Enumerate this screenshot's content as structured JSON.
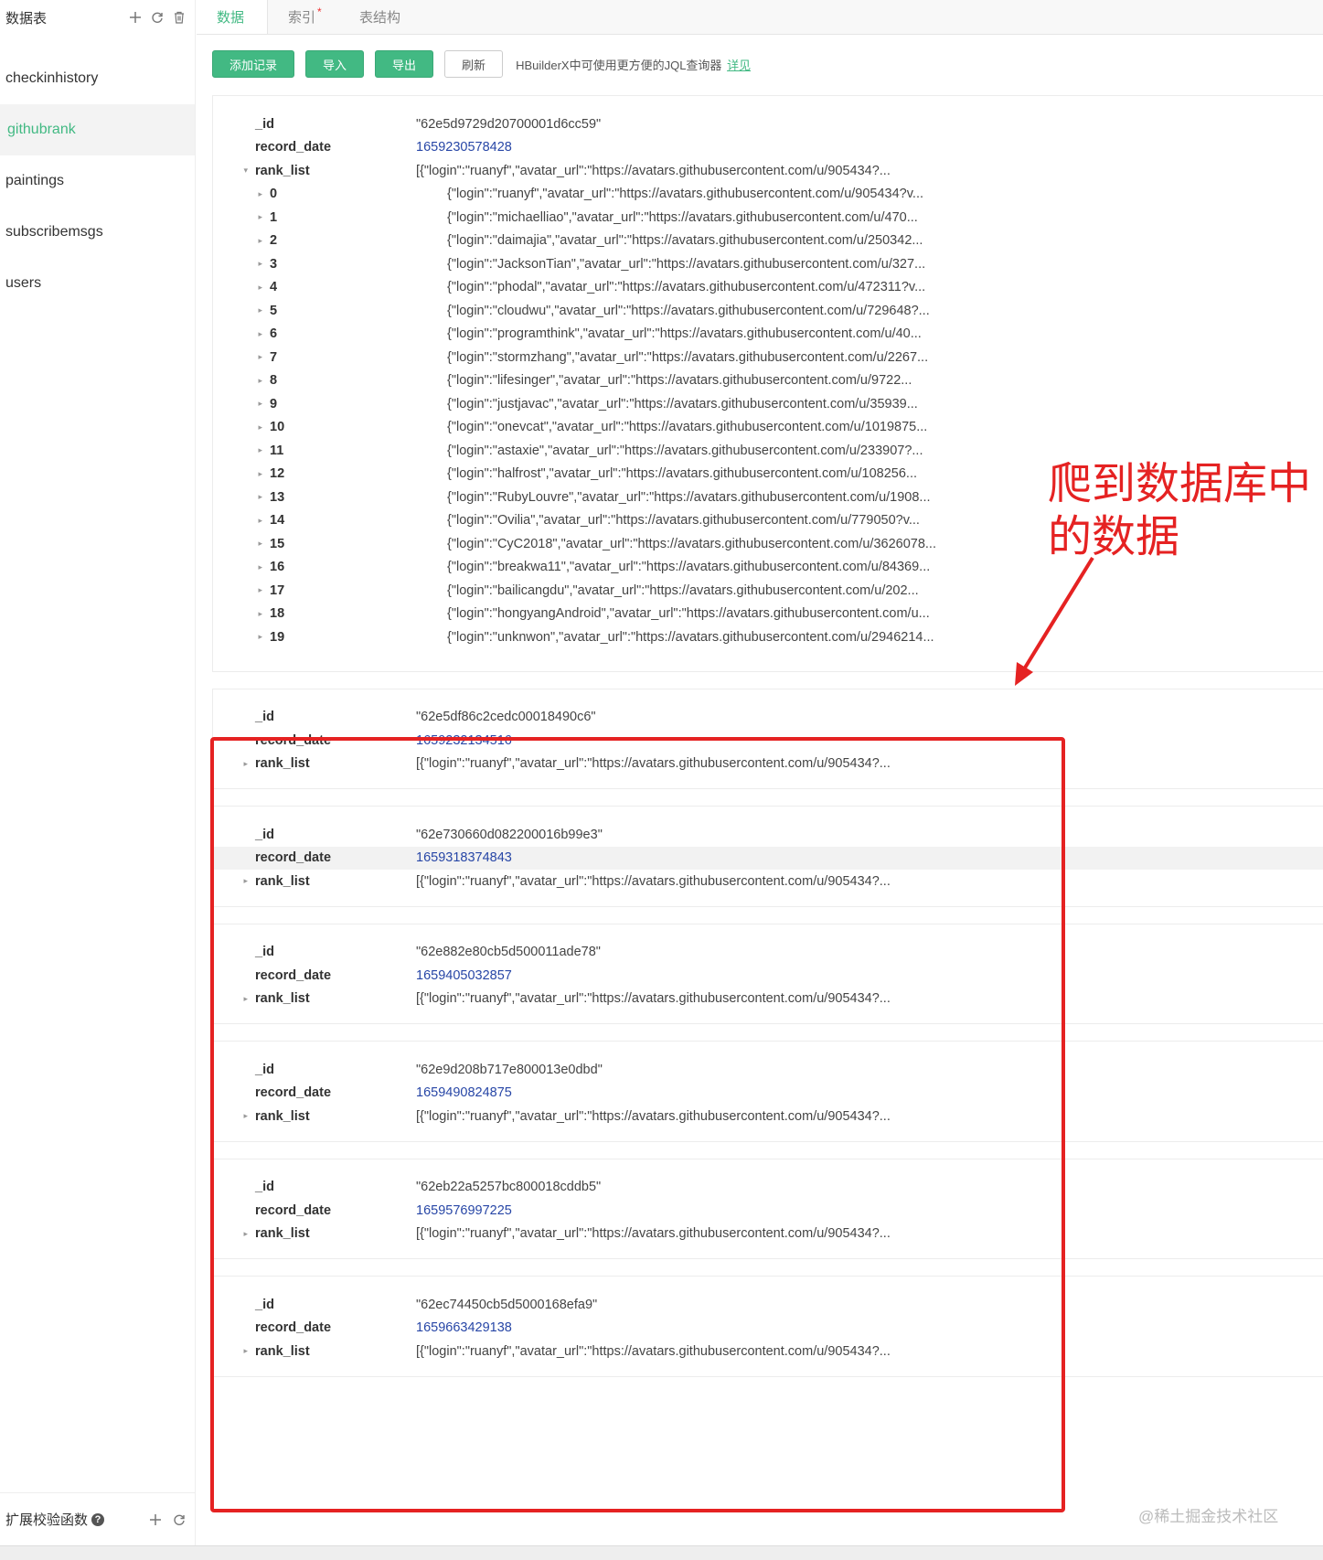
{
  "sidebar": {
    "title": "数据表",
    "items": [
      "checkinhistory",
      "githubrank",
      "paintings",
      "subscribemsgs",
      "users"
    ],
    "active_index": 1,
    "footer_title": "扩展校验函数",
    "help_glyph": "?"
  },
  "tabs": [
    {
      "label": "数据",
      "active": true
    },
    {
      "label": "索引",
      "active": false,
      "star": "*"
    },
    {
      "label": "表结构",
      "active": false
    }
  ],
  "toolbar": {
    "add": "添加记录",
    "import": "导入",
    "export": "导出",
    "refresh": "刷新",
    "note": "HBuilderX中可使用更方便的JQL查询器",
    "note_link": "详见"
  },
  "records": [
    {
      "id": "\"62e5d9729d20700001d6cc59\"",
      "record_date": "1659230578428",
      "rank_list": "[{\"login\":\"ruanyf\",\"avatar_url\":\"https://avatars.githubusercontent.com/u/905434?...",
      "expanded": true,
      "items": [
        {
          "i": "0",
          "v": "{\"login\":\"ruanyf\",\"avatar_url\":\"https://avatars.githubusercontent.com/u/905434?v..."
        },
        {
          "i": "1",
          "v": "{\"login\":\"michaelliao\",\"avatar_url\":\"https://avatars.githubusercontent.com/u/470..."
        },
        {
          "i": "2",
          "v": "{\"login\":\"daimajia\",\"avatar_url\":\"https://avatars.githubusercontent.com/u/250342..."
        },
        {
          "i": "3",
          "v": "{\"login\":\"JacksonTian\",\"avatar_url\":\"https://avatars.githubusercontent.com/u/327..."
        },
        {
          "i": "4",
          "v": "{\"login\":\"phodal\",\"avatar_url\":\"https://avatars.githubusercontent.com/u/472311?v..."
        },
        {
          "i": "5",
          "v": "{\"login\":\"cloudwu\",\"avatar_url\":\"https://avatars.githubusercontent.com/u/729648?..."
        },
        {
          "i": "6",
          "v": "{\"login\":\"programthink\",\"avatar_url\":\"https://avatars.githubusercontent.com/u/40..."
        },
        {
          "i": "7",
          "v": "{\"login\":\"stormzhang\",\"avatar_url\":\"https://avatars.githubusercontent.com/u/2267..."
        },
        {
          "i": "8",
          "v": "{\"login\":\"lifesinger\",\"avatar_url\":\"https://avatars.githubusercontent.com/u/9722..."
        },
        {
          "i": "9",
          "v": "{\"login\":\"justjavac\",\"avatar_url\":\"https://avatars.githubusercontent.com/u/35939..."
        },
        {
          "i": "10",
          "v": "{\"login\":\"onevcat\",\"avatar_url\":\"https://avatars.githubusercontent.com/u/1019875..."
        },
        {
          "i": "11",
          "v": "{\"login\":\"astaxie\",\"avatar_url\":\"https://avatars.githubusercontent.com/u/233907?..."
        },
        {
          "i": "12",
          "v": "{\"login\":\"halfrost\",\"avatar_url\":\"https://avatars.githubusercontent.com/u/108256..."
        },
        {
          "i": "13",
          "v": "{\"login\":\"RubyLouvre\",\"avatar_url\":\"https://avatars.githubusercontent.com/u/1908..."
        },
        {
          "i": "14",
          "v": "{\"login\":\"Ovilia\",\"avatar_url\":\"https://avatars.githubusercontent.com/u/779050?v..."
        },
        {
          "i": "15",
          "v": "{\"login\":\"CyC2018\",\"avatar_url\":\"https://avatars.githubusercontent.com/u/3626078..."
        },
        {
          "i": "16",
          "v": "{\"login\":\"breakwa11\",\"avatar_url\":\"https://avatars.githubusercontent.com/u/84369..."
        },
        {
          "i": "17",
          "v": "{\"login\":\"bailicangdu\",\"avatar_url\":\"https://avatars.githubusercontent.com/u/202..."
        },
        {
          "i": "18",
          "v": "{\"login\":\"hongyangAndroid\",\"avatar_url\":\"https://avatars.githubusercontent.com/u..."
        },
        {
          "i": "19",
          "v": "{\"login\":\"unknwon\",\"avatar_url\":\"https://avatars.githubusercontent.com/u/2946214..."
        }
      ]
    },
    {
      "id": "\"62e5df86c2cedc00018490c6\"",
      "record_date": "1659232134516",
      "rank_list": "[{\"login\":\"ruanyf\",\"avatar_url\":\"https://avatars.githubusercontent.com/u/905434?...",
      "expanded": false
    },
    {
      "id": "\"62e730660d082200016b99e3\"",
      "record_date": "1659318374843",
      "rank_list": "[{\"login\":\"ruanyf\",\"avatar_url\":\"https://avatars.githubusercontent.com/u/905434?...",
      "expanded": false,
      "highlight": "record_date"
    },
    {
      "id": "\"62e882e80cb5d500011ade78\"",
      "record_date": "1659405032857",
      "rank_list": "[{\"login\":\"ruanyf\",\"avatar_url\":\"https://avatars.githubusercontent.com/u/905434?...",
      "expanded": false
    },
    {
      "id": "\"62e9d208b717e800013e0dbd\"",
      "record_date": "1659490824875",
      "rank_list": "[{\"login\":\"ruanyf\",\"avatar_url\":\"https://avatars.githubusercontent.com/u/905434?...",
      "expanded": false
    },
    {
      "id": "\"62eb22a5257bc800018cddb5\"",
      "record_date": "1659576997225",
      "rank_list": "[{\"login\":\"ruanyf\",\"avatar_url\":\"https://avatars.githubusercontent.com/u/905434?...",
      "expanded": false
    },
    {
      "id": "\"62ec74450cb5d5000168efa9\"",
      "record_date": "1659663429138",
      "rank_list": "[{\"login\":\"ruanyf\",\"avatar_url\":\"https://avatars.githubusercontent.com/u/905434?...",
      "expanded": false
    }
  ],
  "field_labels": {
    "id": "_id",
    "record_date": "record_date",
    "rank_list": "rank_list"
  },
  "annotation": {
    "line1": "爬到数据库中",
    "line2": "的数据",
    "color": "#e52222"
  },
  "watermark": "@稀土掘金技术社区",
  "colors": {
    "accent": "#42b983",
    "number": "#2746a6"
  }
}
